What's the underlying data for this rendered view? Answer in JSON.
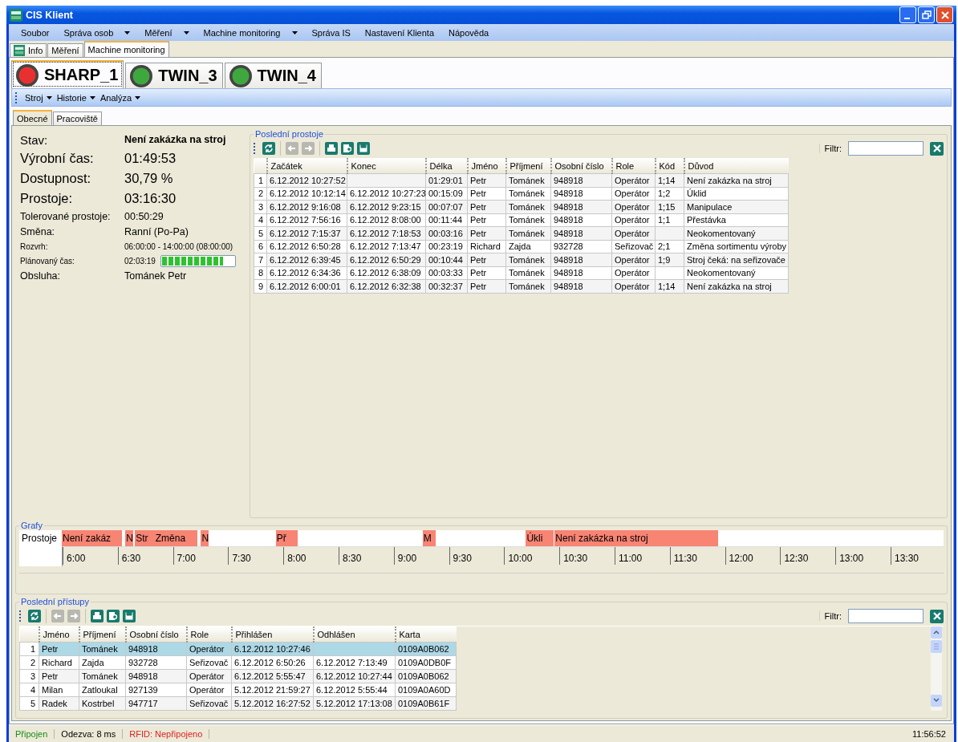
{
  "window": {
    "title": "CIS Klient"
  },
  "menu": [
    {
      "label": "Soubor",
      "dropdown": false
    },
    {
      "label": "Správa osob",
      "dropdown": true
    },
    {
      "label": "Měření",
      "dropdown": true
    },
    {
      "label": "Machine monitoring",
      "dropdown": true
    },
    {
      "label": "Správa IS",
      "dropdown": false
    },
    {
      "label": "Nastavení Klienta",
      "dropdown": false
    },
    {
      "label": "Nápověda",
      "dropdown": false
    }
  ],
  "tabs": [
    {
      "label": "Info",
      "kind": "logo",
      "selected": false
    },
    {
      "label": "Měření",
      "kind": "plain",
      "selected": false
    },
    {
      "label": "Machine monitoring",
      "kind": "plain",
      "selected": true
    }
  ],
  "machines": [
    {
      "label": "SHARP_1",
      "color": "#e83030",
      "selected": true
    },
    {
      "label": "TWIN_3",
      "color": "#3ea83e",
      "selected": false
    },
    {
      "label": "TWIN_4",
      "color": "#3ea83e",
      "selected": false
    }
  ],
  "machine_menu": [
    {
      "label": "Stroj"
    },
    {
      "label": "Historie"
    },
    {
      "label": "Analýza"
    }
  ],
  "subtabs": [
    {
      "label": "Obecné",
      "selected": true
    },
    {
      "label": "Pracoviště",
      "selected": false
    }
  ],
  "summary": [
    {
      "kind": "status",
      "label": "Stav:",
      "value": "Není zakázka na stroj"
    },
    {
      "kind": "large",
      "label": "Výrobní čas:",
      "value": "01:49:53"
    },
    {
      "kind": "large",
      "label": "Dostupnost:",
      "value": "30,79 %"
    },
    {
      "kind": "large",
      "label": "Prostoje:",
      "value": "03:16:30"
    },
    {
      "kind": "normal",
      "label": "Tolerované prostoje:",
      "value": "00:50:29"
    },
    {
      "kind": "normal",
      "label": "Směna:",
      "value": "Ranní (Po-Pa)"
    },
    {
      "kind": "small",
      "label": "Rozvrh:",
      "value": "06:00:00 - 14:00:00 (08:00:00)"
    },
    {
      "kind": "progress",
      "label": "Plánovaný čas:",
      "value": "02:03:19",
      "level": 0.85
    },
    {
      "kind": "normal",
      "label": "Obsluha:",
      "value": "Tománek Petr"
    }
  ],
  "downtimes": {
    "title": "Poslední prostoje",
    "toolbar": [
      {
        "kind": "refresh",
        "disabled": false
      },
      {
        "kind": "back",
        "disabled": true
      },
      {
        "kind": "forward",
        "disabled": true
      },
      {
        "kind": "print",
        "disabled": false
      },
      {
        "kind": "preview",
        "disabled": false
      },
      {
        "kind": "save",
        "disabled": false
      }
    ],
    "filter_label": "Filtr:",
    "columns": [
      "",
      "Začátek",
      "Konec",
      "Délka",
      "Jméno",
      "Příjmení",
      "Osobní číslo",
      "Role",
      "Kód",
      "Důvod"
    ],
    "rows": [
      [
        "1",
        "6.12.2012 10:27:52",
        "",
        "01:29:01",
        "Petr",
        "Tománek",
        "948918",
        "Operátor",
        "1;14",
        "Není zakázka na stroj"
      ],
      [
        "2",
        "6.12.2012 10:12:14",
        "6.12.2012 10:27:23",
        "00:15:09",
        "Petr",
        "Tománek",
        "948918",
        "Operátor",
        "1;2",
        "Úklid"
      ],
      [
        "3",
        "6.12.2012 9:16:08",
        "6.12.2012 9:23:15",
        "00:07:07",
        "Petr",
        "Tománek",
        "948918",
        "Operátor",
        "1;15",
        "Manipulace"
      ],
      [
        "4",
        "6.12.2012 7:56:16",
        "6.12.2012 8:08:00",
        "00:11:44",
        "Petr",
        "Tománek",
        "948918",
        "Operátor",
        "1;1",
        "Přestávka"
      ],
      [
        "5",
        "6.12.2012 7:15:37",
        "6.12.2012 7:18:53",
        "00:03:16",
        "Petr",
        "Tománek",
        "948918",
        "Operátor",
        "",
        "Neokomentovaný"
      ],
      [
        "6",
        "6.12.2012 6:50:28",
        "6.12.2012 7:13:47",
        "00:23:19",
        "Richard",
        "Zajda",
        "932728",
        "Seřizovač",
        "2;1",
        "Změna sortimentu výroby"
      ],
      [
        "7",
        "6.12.2012 6:39:45",
        "6.12.2012 6:50:29",
        "00:10:44",
        "Petr",
        "Tománek",
        "948918",
        "Operátor",
        "1;9",
        "Stroj čeká: na seřizovače"
      ],
      [
        "8",
        "6.12.2012 6:34:36",
        "6.12.2012 6:38:09",
        "00:03:33",
        "Petr",
        "Tománek",
        "948918",
        "Operátor",
        "",
        "Neokomentovaný"
      ],
      [
        "9",
        "6.12.2012 6:00:01",
        "6.12.2012 6:32:38",
        "00:32:37",
        "Petr",
        "Tománek",
        "948918",
        "Operátor",
        "1;14",
        "Není zakázka na stroj"
      ]
    ]
  },
  "graphs": {
    "title": "Grafy",
    "row_label": "Prostoje",
    "segments": [
      {
        "label": "Není zakáz"
      },
      {
        "label": "N"
      },
      {
        "label": "Str"
      },
      {
        "label": "Změna"
      },
      {
        "label": "N"
      },
      {
        "label": "Př"
      },
      {
        "label": "M"
      },
      {
        "label": "Úkli"
      },
      {
        "label": "Není zakázka na stroj"
      }
    ],
    "ticks": [
      "6:00",
      "6:30",
      "7:00",
      "7:30",
      "8:00",
      "8:30",
      "9:00",
      "9:30",
      "10:00",
      "10:30",
      "11:00",
      "11:30",
      "12:00",
      "12:30",
      "13:00",
      "13:30"
    ]
  },
  "accesses": {
    "title": "Poslední přístupy",
    "toolbar": [
      {
        "kind": "refresh",
        "disabled": false
      },
      {
        "kind": "back",
        "disabled": true
      },
      {
        "kind": "forward",
        "disabled": true
      },
      {
        "kind": "print",
        "disabled": false
      },
      {
        "kind": "preview",
        "disabled": false
      },
      {
        "kind": "save",
        "disabled": false
      }
    ],
    "filter_label": "Filtr:",
    "columns": [
      "",
      "Jméno",
      "Příjmení",
      "Osobní číslo",
      "Role",
      "Přihlášen",
      "Odhlášen",
      "Karta"
    ],
    "rows": [
      {
        "selected": true,
        "cells": [
          "1",
          "Petr",
          "Tománek",
          "948918",
          "Operátor",
          "6.12.2012 10:27:46",
          "",
          "0109A0B062"
        ]
      },
      {
        "selected": false,
        "cells": [
          "2",
          "Richard",
          "Zajda",
          "932728",
          "Seřizovač",
          "6.12.2012 6:50:26",
          "6.12.2012 7:13:49",
          "0109A0DB0F"
        ]
      },
      {
        "selected": false,
        "cells": [
          "3",
          "Petr",
          "Tománek",
          "948918",
          "Operátor",
          "6.12.2012 5:55:47",
          "6.12.2012 10:27:44",
          "0109A0B062"
        ]
      },
      {
        "selected": false,
        "cells": [
          "4",
          "Milan",
          "Zatloukal",
          "927139",
          "Operátor",
          "5.12.2012 21:59:27",
          "6.12.2012 5:55:44",
          "0109A0A60D"
        ]
      },
      {
        "selected": false,
        "cells": [
          "5",
          "Radek",
          "Kostrbel",
          "947717",
          "Seřizovač",
          "5.12.2012 16:27:52",
          "5.12.2012 17:13:08",
          "0109A0B61F"
        ]
      }
    ]
  },
  "status_bar": {
    "connection": "Připojen",
    "latency": "Odezva: 8 ms",
    "rfid": "RFID: Nepřipojeno",
    "time": "11:56:52"
  }
}
